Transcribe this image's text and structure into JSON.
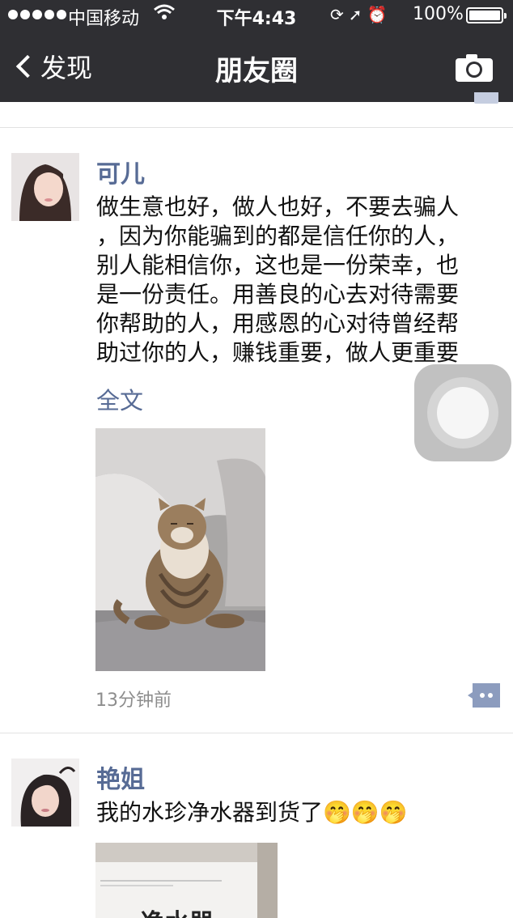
{
  "status_bar": {
    "carrier": "中国移动",
    "time": "下午4:43",
    "battery": "100%"
  },
  "nav": {
    "back_label": "发现",
    "title": "朋友圈"
  },
  "posts": [
    {
      "name": "可儿",
      "text_lines": [
        "做生意也好，做人也好，不要去骗人",
        "，因为你能骗到的都是信任你的人，",
        "别人能相信你，这也是一份荣幸，也",
        "是一份责任。用善良的心去对待需要",
        "你帮助的人，用感恩的心对待曾经帮",
        "助过你的人，赚钱重要，做人更重要"
      ],
      "full_text_label": "全文",
      "time_ago": "13分钟前"
    },
    {
      "name": "艳姐",
      "text": "我的水珍净水器到货了🤭🤭🤭",
      "photo_caption": "净水器"
    }
  ],
  "colors": {
    "nav_background": "#2f2f33",
    "name_blue": "#576b95",
    "time_gray": "#8d8d8d"
  },
  "icons": [
    "signal-dots-icon",
    "wifi-icon",
    "rotation-lock-icon",
    "location-icon",
    "alarm-icon",
    "battery-icon",
    "back-chevron-icon",
    "camera-icon",
    "comment-icon"
  ]
}
